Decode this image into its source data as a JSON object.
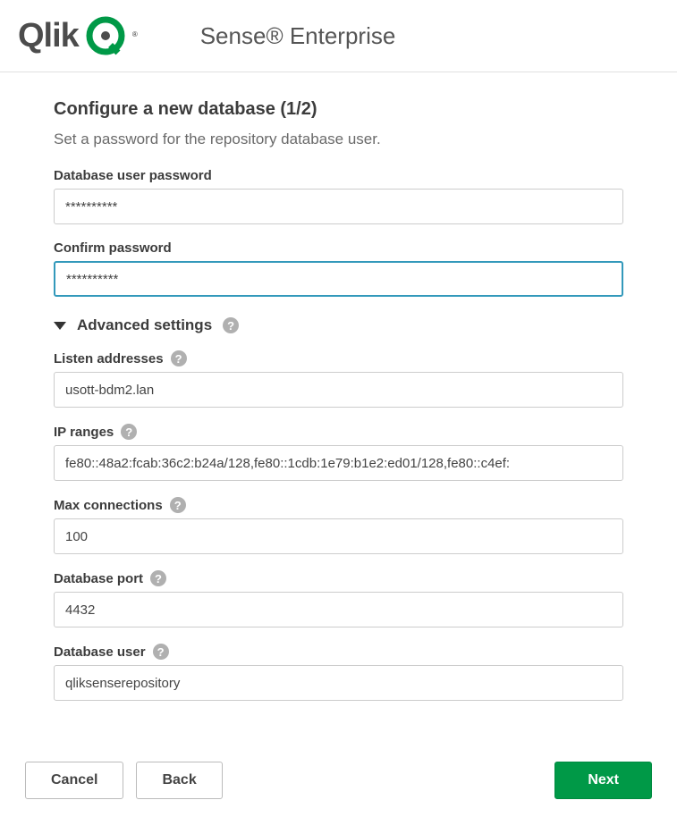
{
  "header": {
    "logo_text": "Qlik",
    "product_title": "Sense® Enterprise"
  },
  "page": {
    "title": "Configure a new database (1/2)",
    "subtitle": "Set a password for the repository database user."
  },
  "fields": {
    "password": {
      "label": "Database user password",
      "value": "**********"
    },
    "confirm": {
      "label": "Confirm password",
      "value": "**********"
    },
    "listen": {
      "label": "Listen addresses",
      "value": "usott-bdm2.lan"
    },
    "ipranges": {
      "label": "IP ranges",
      "value": "fe80::48a2:fcab:36c2:b24a/128,fe80::1cdb:1e79:b1e2:ed01/128,fe80::c4ef:"
    },
    "maxconn": {
      "label": "Max connections",
      "value": "100"
    },
    "port": {
      "label": "Database port",
      "value": "4432"
    },
    "dbuser": {
      "label": "Database user",
      "value": "qliksenserepository"
    }
  },
  "section": {
    "advanced": "Advanced settings"
  },
  "buttons": {
    "cancel": "Cancel",
    "back": "Back",
    "next": "Next"
  }
}
